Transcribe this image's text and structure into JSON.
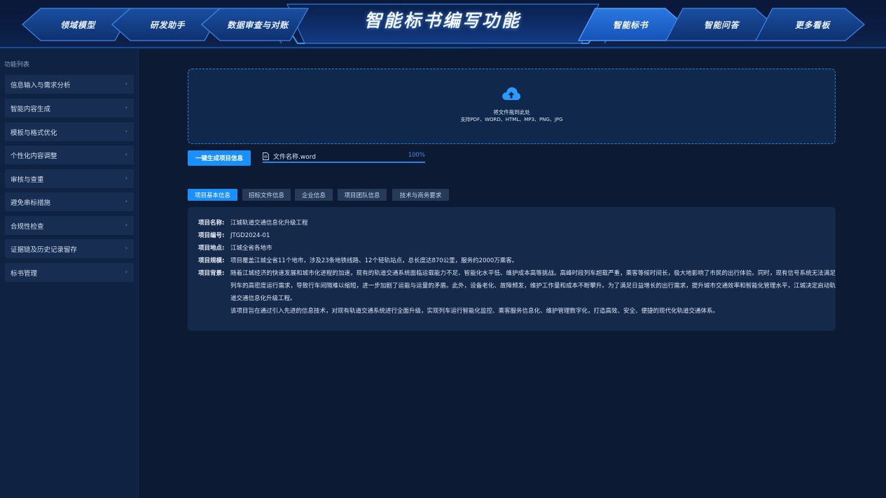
{
  "nav": {
    "left_items": [
      "领域模型",
      "研发助手",
      "数据审查与对账"
    ],
    "title": "智能标书编写功能",
    "right_items": [
      "智能标书",
      "智能问答",
      "更多看板"
    ],
    "active": "智能标书"
  },
  "sidebar": {
    "title": "功能列表",
    "items": [
      {
        "label": "信息输入与需求分析"
      },
      {
        "label": "智能内容生成"
      },
      {
        "label": "模板与格式优化"
      },
      {
        "label": "个性化内容调整"
      },
      {
        "label": "审核与查重"
      },
      {
        "label": "避免串标措施"
      },
      {
        "label": "合规性检查"
      },
      {
        "label": "证据链及历史记录留存"
      },
      {
        "label": "标书管理"
      }
    ]
  },
  "upload": {
    "hint": "将文件拖到此处",
    "formats": "支持PDF、WORD、HTML、MP3、PNG、JPG"
  },
  "generate_button": "一键生成项目信息",
  "file": {
    "name": "文件名称.word",
    "progress_text": "100%",
    "progress": 1.0
  },
  "tabs": [
    {
      "label": "项目基本信息",
      "active": true
    },
    {
      "label": "招标文件信息",
      "active": false
    },
    {
      "label": "企业信息",
      "active": false
    },
    {
      "label": "项目团队信息",
      "active": false
    },
    {
      "label": "技术与商务要求",
      "active": false
    }
  ],
  "project": {
    "name_label": "项目名称:",
    "name": "江城轨道交通信息化升级工程",
    "code_label": "项目编号:",
    "code": "JTGD2024-01",
    "location_label": "项目地点:",
    "location": "江城全省各地市",
    "scale_label": "项目规模:",
    "scale": "项目覆盖江城全省11个地市，涉及23条地铁线路、12个轻轨站点，总长度达870公里，服务约2000万乘客。",
    "background_label": "项目背景:",
    "background": "随着江城经济的快速发展和城市化进程的加速，现有的轨道交通系统面临运载能力不足、智能化水平低、维护成本高等挑战。高峰时段列车超载严重，乘客等候时间长，极大地影响了市民的出行体验。同时，现有信号系统无法满足列车的高密度运行需求，导致行车间隔难以缩短，进一步加剧了运能与运量的矛盾。此外，设备老化、故障频发，维护工作量和成本不断攀升。为了满足日益增长的出行需求，提升城市交通效率和智能化管理水平，江城决定启动轨道交通信息化升级工程。",
    "background_2": "该项目旨在通过引入先进的信息技术，对现有轨道交通系统进行全面升级，实现列车运行智能化监控、乘客服务信息化、维护管理数字化，打造高效、安全、便捷的现代化轨道交通体系。"
  },
  "colors": {
    "accent": "#1890ff",
    "panel": "#15294b",
    "background": "#0c1a33",
    "sidebar": "#0f2242"
  },
  "icons": {
    "upload": "cloud-upload-icon",
    "file": "document-icon",
    "chevron": "chevron-right-icon"
  }
}
